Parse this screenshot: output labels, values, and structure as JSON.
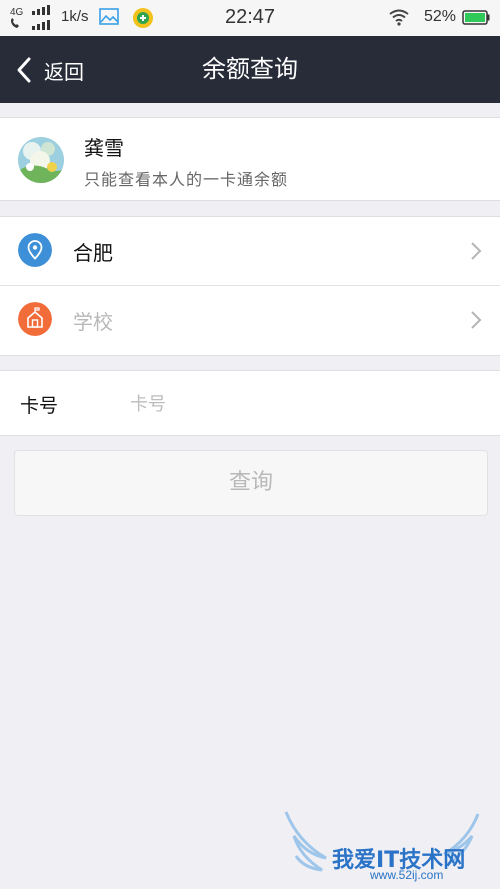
{
  "status_bar": {
    "network": "4G",
    "speed": "1k/s",
    "time": "22:47",
    "battery_percent": "52%",
    "icons": [
      "signal-icon",
      "gallery-icon",
      "app-icon",
      "wifi-icon",
      "battery-icon"
    ]
  },
  "nav": {
    "back_label": "返回",
    "title": "余额查询"
  },
  "user": {
    "name": "龚雪",
    "subtitle": "只能查看本人的一卡通余额"
  },
  "location": {
    "city": "合肥",
    "school_placeholder": "学校"
  },
  "card_form": {
    "label": "卡号",
    "placeholder": "卡号",
    "value": ""
  },
  "query_button": "查询",
  "watermark": {
    "text": "我爱IT技术网",
    "url": "www.52ij.com"
  },
  "colors": {
    "nav_bg": "#272c38",
    "page_bg": "#efeff4",
    "location_icon": "#3d8fd8",
    "school_icon": "#f26c3a"
  }
}
